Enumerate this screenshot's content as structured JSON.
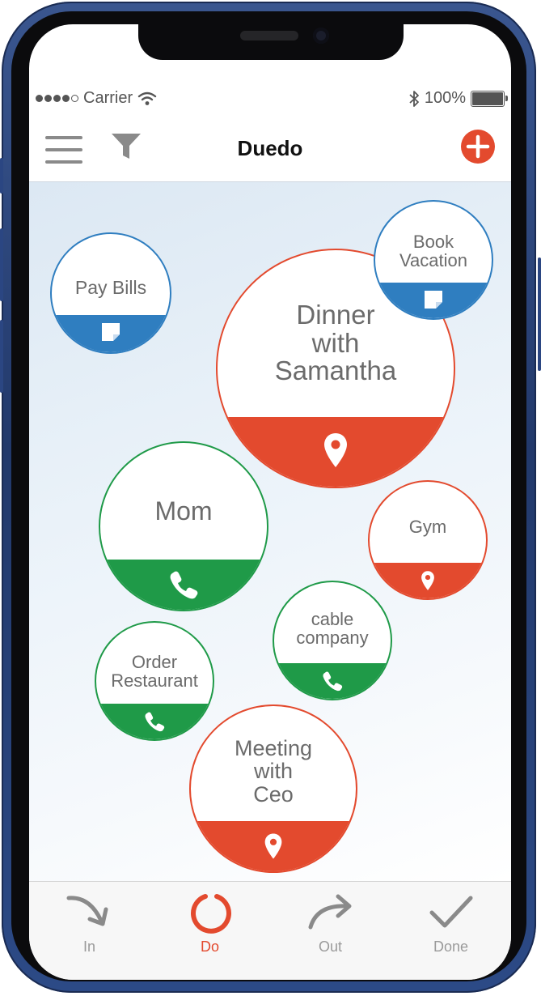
{
  "status_bar": {
    "carrier": "Carrier",
    "battery": "100%"
  },
  "header": {
    "title": "Duedo"
  },
  "bubbles": [
    {
      "label": "Pay Bills",
      "color": "#2f7ec0",
      "icon": "note-icon"
    },
    {
      "label": "Book\nVacation",
      "color": "#2f7ec0",
      "icon": "note-icon"
    },
    {
      "label": "Dinner\nwith\nSamantha",
      "color": "#e34a2e",
      "icon": "location-pin-icon"
    },
    {
      "label": "Mom",
      "color": "#1f9a48",
      "icon": "phone-icon"
    },
    {
      "label": "Gym",
      "color": "#e34a2e",
      "icon": "location-pin-icon"
    },
    {
      "label": "cable\ncompany",
      "color": "#1f9a48",
      "icon": "phone-icon"
    },
    {
      "label": "Order\nRestaurant",
      "color": "#1f9a48",
      "icon": "phone-icon"
    },
    {
      "label": "Meeting\nwith\nCeo",
      "color": "#e34a2e",
      "icon": "location-pin-icon"
    }
  ],
  "tabs": [
    {
      "label": "In",
      "icon": "arrow-in-icon"
    },
    {
      "label": "Do",
      "icon": "circle-icon",
      "active": true
    },
    {
      "label": "Out",
      "icon": "arrow-out-icon"
    },
    {
      "label": "Done",
      "icon": "check-icon"
    }
  ],
  "colors": {
    "accent": "#e34a2e",
    "blue": "#2f7ec0",
    "green": "#1f9a48"
  }
}
